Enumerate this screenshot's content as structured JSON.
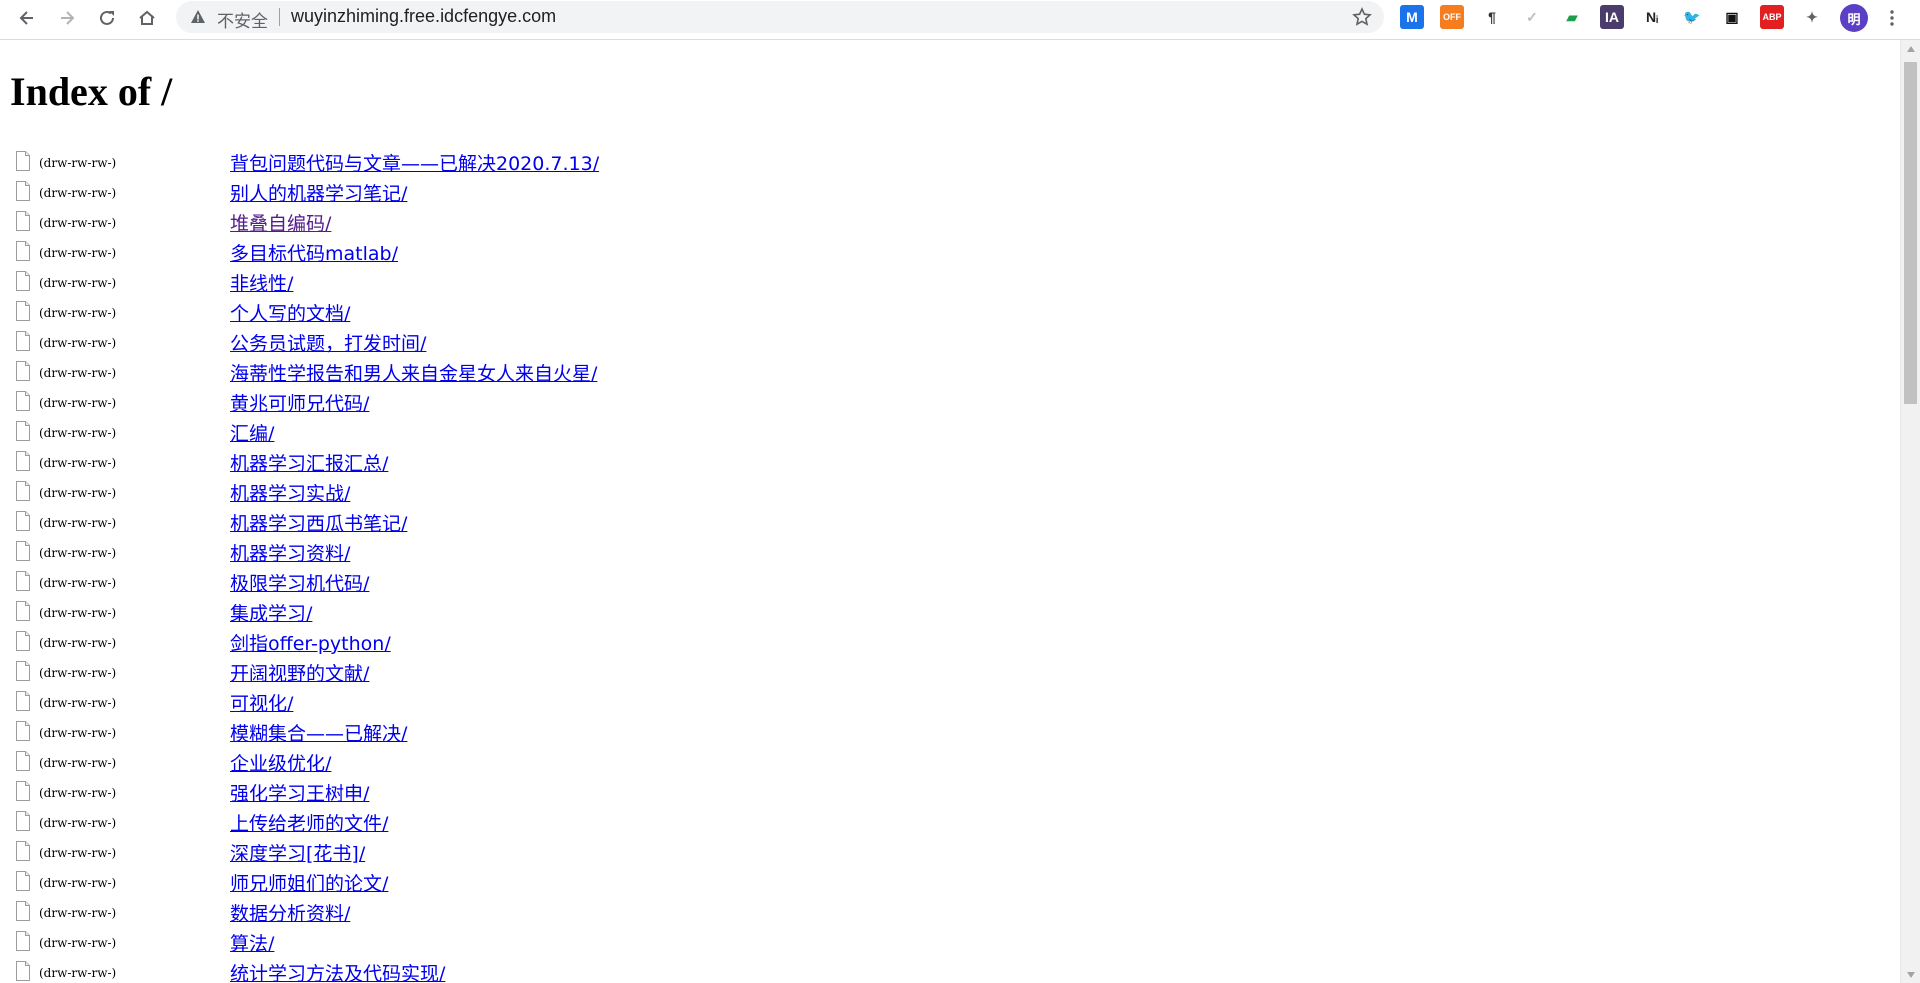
{
  "browser": {
    "security_status": "不安全",
    "url": "wuyinzhiming.free.idcfengye.com",
    "extensions": [
      {
        "name": "m-ext-icon",
        "label": "M",
        "bg": "#1a73e8",
        "fg": "#ffffff"
      },
      {
        "name": "off-ext-icon",
        "label": "OFF",
        "bg": "#f57c1f",
        "fg": "#ffffff"
      },
      {
        "name": "pilcrow-ext-icon",
        "label": "¶",
        "bg": "#ffffff",
        "fg": "#333333"
      },
      {
        "name": "check-ext-icon",
        "label": "✓",
        "bg": "#ffffff",
        "fg": "#bdbdbd"
      },
      {
        "name": "flag-ext-icon",
        "label": "▰",
        "bg": "#ffffff",
        "fg": "#1e9e4a"
      },
      {
        "name": "ia-ext-icon",
        "label": "IA",
        "bg": "#4a3d6b",
        "fg": "#ffffff"
      },
      {
        "name": "ni-ext-icon",
        "label": "Nᵢ",
        "bg": "#ffffff",
        "fg": "#222222"
      },
      {
        "name": "bird-ext-icon",
        "label": "🐦",
        "bg": "#ffffff",
        "fg": "#111111"
      },
      {
        "name": "tab-ext-icon",
        "label": "▣",
        "bg": "#ffffff",
        "fg": "#111111"
      },
      {
        "name": "adblock-ext-icon",
        "label": "ABP",
        "bg": "#e32020",
        "fg": "#ffffff"
      },
      {
        "name": "puzzle-ext-icon",
        "label": "✦",
        "bg": "#ffffff",
        "fg": "#5f6368"
      }
    ],
    "profile_initial": "明",
    "profile_color": "#5b3fc4"
  },
  "page": {
    "title": "Index of /",
    "entries": [
      {
        "perm": "(drw-rw-rw-)",
        "name": "背包问题代码与文章——已解决2020.7.13/",
        "visited": false
      },
      {
        "perm": "(drw-rw-rw-)",
        "name": "别人的机器学习笔记/",
        "visited": false
      },
      {
        "perm": "(drw-rw-rw-)",
        "name": "堆叠自编码/",
        "visited": true
      },
      {
        "perm": "(drw-rw-rw-)",
        "name": "多目标代码matlab/",
        "visited": false
      },
      {
        "perm": "(drw-rw-rw-)",
        "name": "非线性/",
        "visited": false
      },
      {
        "perm": "(drw-rw-rw-)",
        "name": "个人写的文档/",
        "visited": false
      },
      {
        "perm": "(drw-rw-rw-)",
        "name": "公务员试题，打发时间/",
        "visited": false
      },
      {
        "perm": "(drw-rw-rw-)",
        "name": "海蒂性学报告和男人来自金星女人来自火星/",
        "visited": false
      },
      {
        "perm": "(drw-rw-rw-)",
        "name": "黄兆可师兄代码/",
        "visited": false
      },
      {
        "perm": "(drw-rw-rw-)",
        "name": "汇编/",
        "visited": false
      },
      {
        "perm": "(drw-rw-rw-)",
        "name": "机器学习汇报汇总/",
        "visited": false
      },
      {
        "perm": "(drw-rw-rw-)",
        "name": "机器学习实战/",
        "visited": false
      },
      {
        "perm": "(drw-rw-rw-)",
        "name": "机器学习西瓜书笔记/",
        "visited": false
      },
      {
        "perm": "(drw-rw-rw-)",
        "name": "机器学习资料/",
        "visited": false
      },
      {
        "perm": "(drw-rw-rw-)",
        "name": "极限学习机代码/",
        "visited": false
      },
      {
        "perm": "(drw-rw-rw-)",
        "name": "集成学习/",
        "visited": false
      },
      {
        "perm": "(drw-rw-rw-)",
        "name": "剑指offer-python/",
        "visited": false
      },
      {
        "perm": "(drw-rw-rw-)",
        "name": "开阔视野的文献/",
        "visited": false
      },
      {
        "perm": "(drw-rw-rw-)",
        "name": "可视化/",
        "visited": false
      },
      {
        "perm": "(drw-rw-rw-)",
        "name": "模糊集合——已解决/",
        "visited": false
      },
      {
        "perm": "(drw-rw-rw-)",
        "name": "企业级优化/",
        "visited": false
      },
      {
        "perm": "(drw-rw-rw-)",
        "name": "强化学习王树申/",
        "visited": false
      },
      {
        "perm": "(drw-rw-rw-)",
        "name": "上传给老师的文件/",
        "visited": false
      },
      {
        "perm": "(drw-rw-rw-)",
        "name": "深度学习[花书]/",
        "visited": false
      },
      {
        "perm": "(drw-rw-rw-)",
        "name": "师兄师姐们的论文/",
        "visited": false
      },
      {
        "perm": "(drw-rw-rw-)",
        "name": "数据分析资料/",
        "visited": false
      },
      {
        "perm": "(drw-rw-rw-)",
        "name": "算法/",
        "visited": false
      },
      {
        "perm": "(drw-rw-rw-)",
        "name": "统计学习方法及代码实现/",
        "visited": false
      }
    ]
  }
}
